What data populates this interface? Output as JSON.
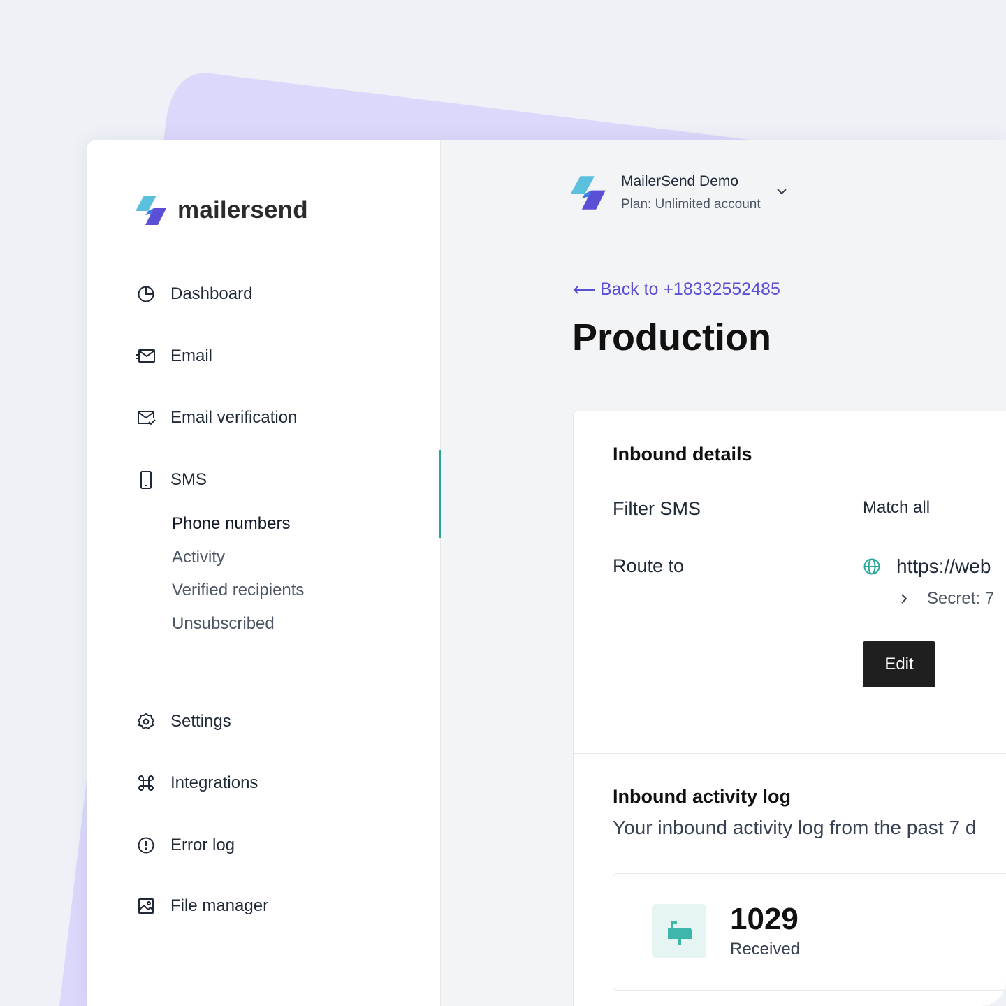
{
  "brand": {
    "name": "mailersend",
    "colors": {
      "logo_top": "#5bc0de",
      "logo_bottom": "#5b4fd6",
      "accent_bar": "#26a69a",
      "link": "#5b4fd6",
      "button": "#1f1f1f"
    }
  },
  "sidebar": {
    "nav": [
      {
        "label": "Dashboard",
        "icon": "pie-chart-icon"
      },
      {
        "label": "Email",
        "icon": "send-mail-icon"
      },
      {
        "label": "Email verification",
        "icon": "mail-check-icon"
      },
      {
        "label": "SMS",
        "icon": "phone-icon"
      }
    ],
    "sms_sub": [
      {
        "label": "Phone numbers",
        "active": true
      },
      {
        "label": "Activity"
      },
      {
        "label": "Verified recipients"
      },
      {
        "label": "Unsubscribed"
      }
    ],
    "nav_bottom": [
      {
        "label": "Settings",
        "icon": "gear-icon"
      },
      {
        "label": "Integrations",
        "icon": "command-icon"
      },
      {
        "label": "Error log",
        "icon": "alert-circle-icon"
      },
      {
        "label": "File manager",
        "icon": "image-icon"
      }
    ]
  },
  "account": {
    "name": "MailerSend Demo",
    "plan": "Plan: Unlimited account"
  },
  "breadcrumb": {
    "back_label": "Back to +18332552485"
  },
  "page": {
    "title": "Production"
  },
  "inbound_details": {
    "title": "Inbound details",
    "filter_label": "Filter SMS",
    "filter_value": "Match all",
    "route_label": "Route to",
    "route_url": "https://web",
    "secret": "Secret: 7",
    "edit_label": "Edit"
  },
  "activity_log": {
    "title": "Inbound activity log",
    "subtitle": "Your inbound activity log from the past 7 d",
    "stat_value": "1029",
    "stat_label": "Received"
  }
}
